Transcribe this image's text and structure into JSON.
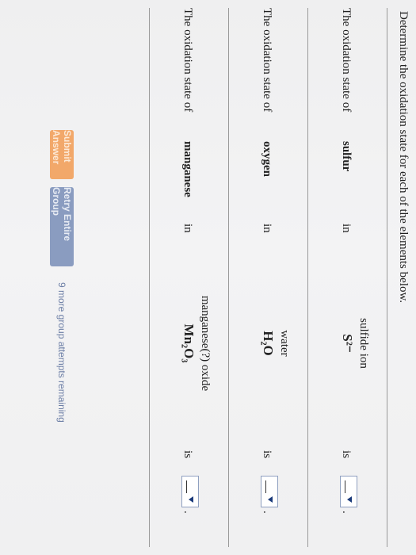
{
  "instruction": "Determine the oxidation state for each of the elements below.",
  "rows": [
    {
      "lead": "The oxidation state of",
      "element": "sulfur",
      "in": "in",
      "compound_name": "sulfide ion",
      "compound_formula": "S²⁻",
      "is": "is",
      "answer": "",
      "period": "."
    },
    {
      "lead": "The oxidation state of",
      "element": "oxygen",
      "in": "in",
      "compound_name": "water",
      "compound_formula": "H₂O",
      "is": "is",
      "answer": "",
      "period": "."
    },
    {
      "lead": "The oxidation state of",
      "element": "manganese",
      "in": "in",
      "compound_name": "manganese(?) oxide",
      "compound_formula": "Mn₂O₃",
      "is": "is",
      "answer": "",
      "period": "."
    }
  ],
  "buttons": {
    "submit_label": "Submit Answer",
    "retry_label": "Retry Entire Group"
  },
  "remaining_text": "9 more group attempts remaining",
  "colors": {
    "submit_bg": "#f2a86a",
    "retry_bg": "#8a9cc0",
    "link_text": "#6d7fa6",
    "dropdown_arrow": "#1a3a7a"
  }
}
